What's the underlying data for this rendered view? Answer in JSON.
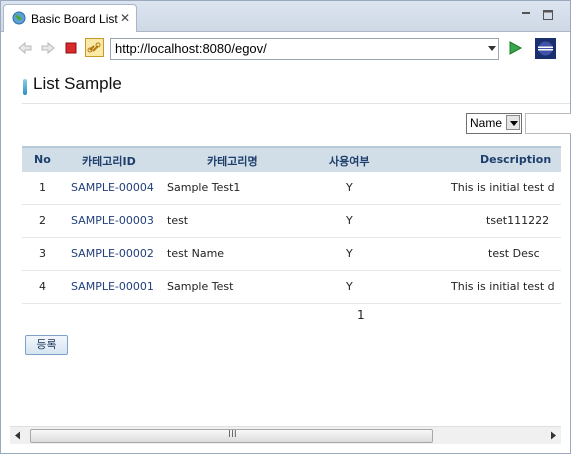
{
  "tab": {
    "title": "Basic Board List",
    "close_glyph": "✕"
  },
  "toolbar": {
    "url": "http://localhost:8080/egov/"
  },
  "page": {
    "title": "List Sample",
    "search_select": "Name",
    "search_value": "",
    "columns": [
      "No",
      "카테고리ID",
      "카테고리명",
      "사용여부",
      "Description"
    ],
    "rows": [
      {
        "no": "1",
        "id": "SAMPLE-00004",
        "name": "Sample Test1",
        "use": "Y",
        "desc": "This is initial test d"
      },
      {
        "no": "2",
        "id": "SAMPLE-00003",
        "name": "test",
        "use": "Y",
        "desc": "tset111222"
      },
      {
        "no": "3",
        "id": "SAMPLE-00002",
        "name": "test Name",
        "use": "Y",
        "desc": "test Desc"
      },
      {
        "no": "4",
        "id": "SAMPLE-00001",
        "name": "Sample Test",
        "use": "Y",
        "desc": "This is initial test d"
      }
    ],
    "pager": "1",
    "register_label": "등록"
  },
  "scrollbar": {
    "grip": "III"
  }
}
